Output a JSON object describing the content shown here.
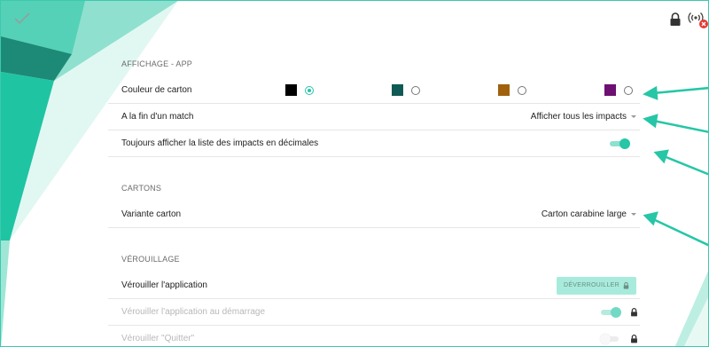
{
  "colors": {
    "accent": "#26c6a6",
    "teal_dark": "#1a7f6d",
    "swatch_black": "#000000",
    "swatch_teal": "#0f5a54",
    "swatch_orange": "#a0610c",
    "swatch_purple": "#6e0f72"
  },
  "affichage": {
    "title": "AFFICHAGE - APP",
    "carton_color_label": "Couleur de carton",
    "swatches": [
      {
        "color": "#000000",
        "selected": true
      },
      {
        "color": "#0f5a54",
        "selected": false
      },
      {
        "color": "#a0610c",
        "selected": false
      },
      {
        "color": "#6e0f72",
        "selected": false
      }
    ],
    "match_end_label": "A la fin d'un match",
    "match_end_value": "Afficher tous les impacts",
    "decimals_label": "Toujours afficher la liste des impacts en décimales",
    "decimals_on": true
  },
  "cartons": {
    "title": "CARTONS",
    "variant_label": "Variante carton",
    "variant_value": "Carton carabine large"
  },
  "verrouillage": {
    "title": "VÉROUILLAGE",
    "lock_app_label": "Vérouiller l'application",
    "unlock_button": "DÉVERROUILLER",
    "lock_startup_label": "Vérouiller l'application au démarrage",
    "lock_startup_on": true,
    "lock_quit_label": "Vérouiller \"Quitter\"",
    "lock_quit_on": false
  },
  "icons": [
    "check-icon",
    "lock-icon",
    "wireless-disconnected-icon",
    "caret-down-icon",
    "lock-small-icon"
  ]
}
